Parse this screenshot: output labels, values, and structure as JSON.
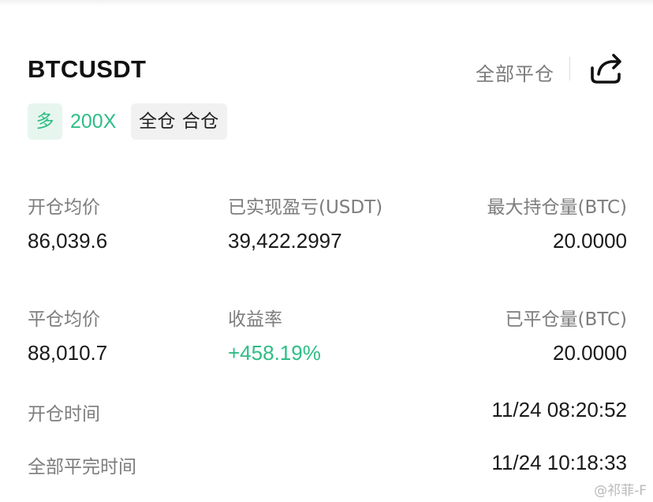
{
  "header": {
    "symbol": "BTCUSDT",
    "close_all_label": "全部平仓",
    "share_icon": "share-icon"
  },
  "badges": {
    "side": "多",
    "leverage": "200X",
    "margin_mode": "全仓 合仓"
  },
  "stats": {
    "avg_open_price_label": "开仓均价",
    "avg_open_price": "86,039.6",
    "realized_pnl_label": "已实现盈亏(USDT)",
    "realized_pnl": "39,422.2997",
    "max_position_label": "最大持仓量(BTC)",
    "max_position": "20.0000",
    "avg_close_price_label": "平仓均价",
    "avg_close_price": "88,010.7",
    "roi_label": "收益率",
    "roi": "+458.19%",
    "closed_amount_label": "已平仓量(BTC)",
    "closed_amount": "20.0000",
    "open_time_label": "开仓时间",
    "open_time": "11/24 08:20:52",
    "close_time_label": "全部平完时间",
    "close_time": "11/24 10:18:33"
  },
  "watermark": "@祁菲-F",
  "colors": {
    "green": "#2ebd85",
    "label_gray": "#7d7d7d"
  }
}
